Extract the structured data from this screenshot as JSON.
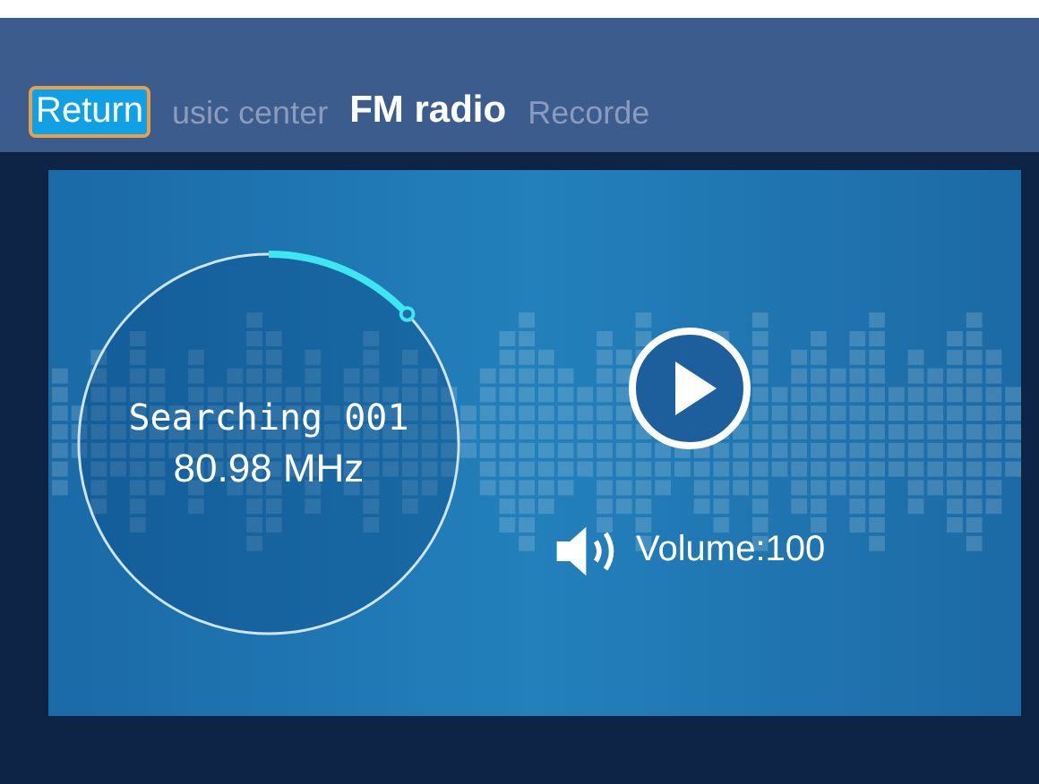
{
  "tabs": [
    {
      "label": "Return",
      "kind": "button",
      "selected": false
    },
    {
      "label": "usic center",
      "kind": "tab",
      "selected": false
    },
    {
      "label": "FM radio",
      "kind": "tab",
      "selected": true
    },
    {
      "label": "Recorde",
      "kind": "tab",
      "selected": false
    }
  ],
  "station": {
    "status": "Searching 001",
    "frequency": "80.98 MHz"
  },
  "volume": {
    "label": "Volume:100"
  }
}
